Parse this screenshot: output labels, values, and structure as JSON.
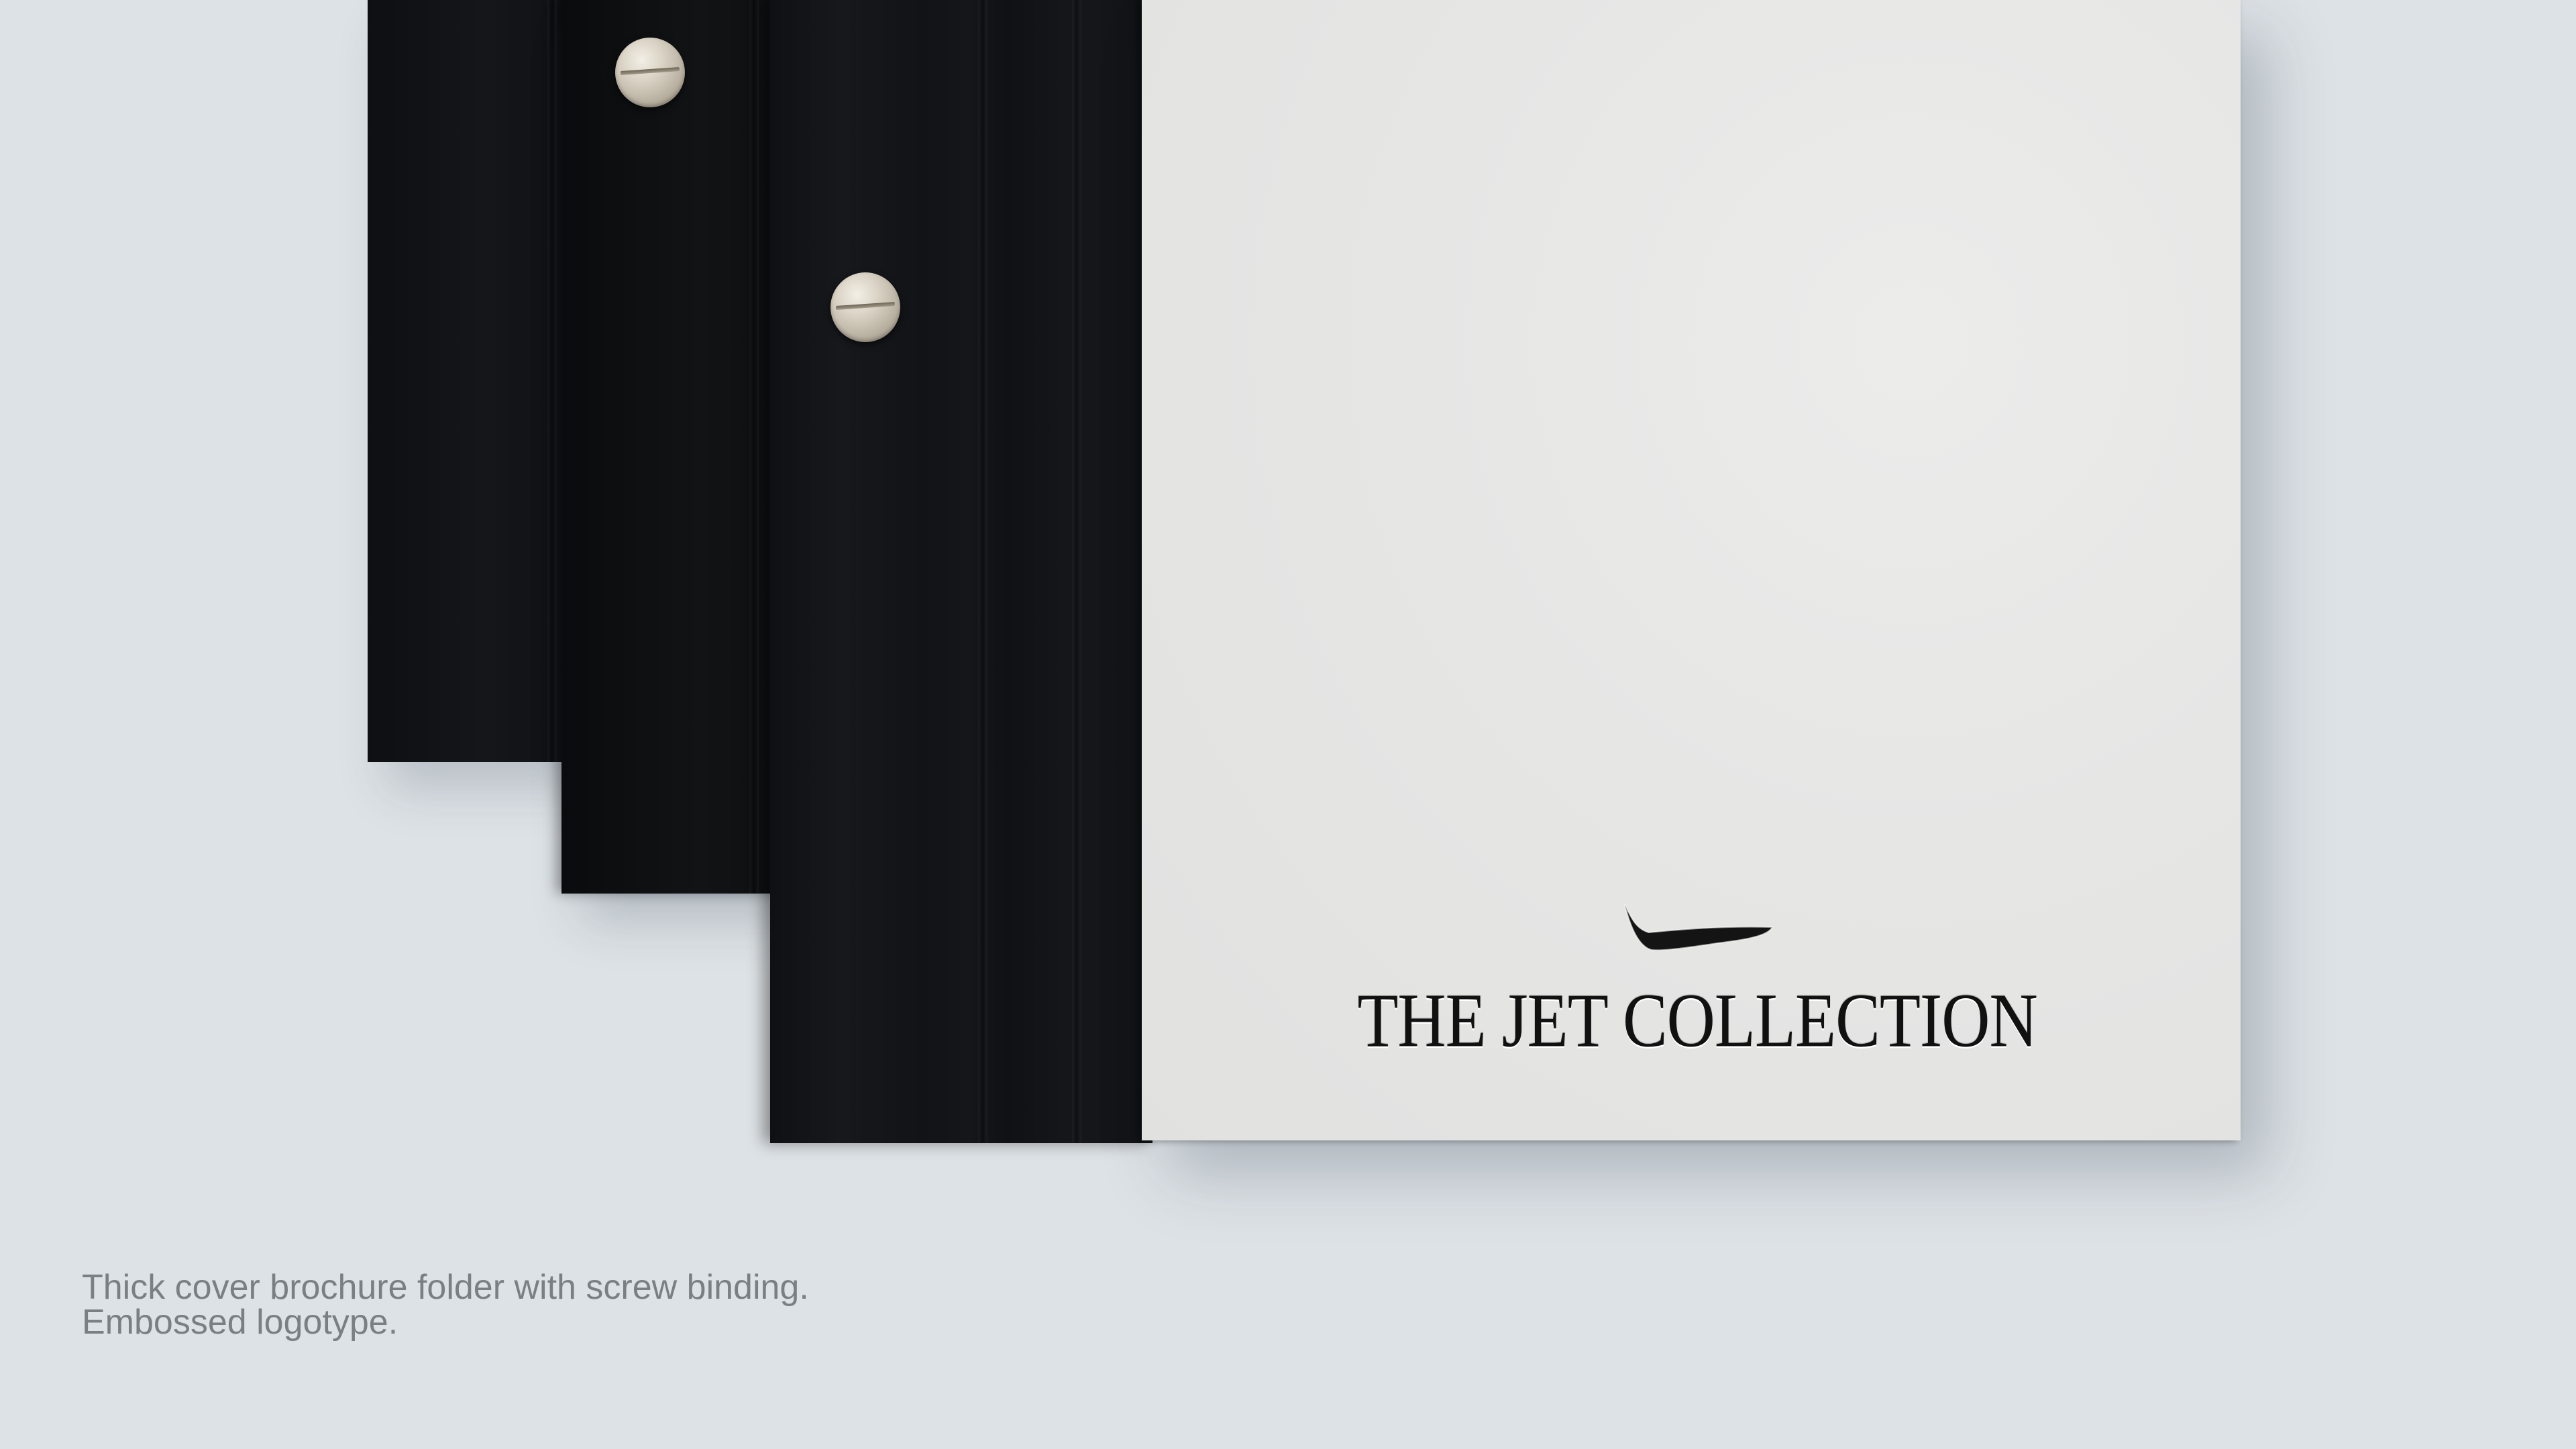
{
  "brochure": {
    "logotype": "THE JET COLLECTION",
    "logo_icon": "jet-swoosh-icon",
    "binding_icon": "screw-icon"
  },
  "caption": {
    "line1": "Thick cover brochure folder with screw binding.",
    "line2": "Embossed logotype."
  },
  "colors": {
    "background": "#dde2e6",
    "folder": "#121417",
    "cover": "#e5e5e4",
    "caption_text": "#7a7f84",
    "logo": "#111111"
  }
}
